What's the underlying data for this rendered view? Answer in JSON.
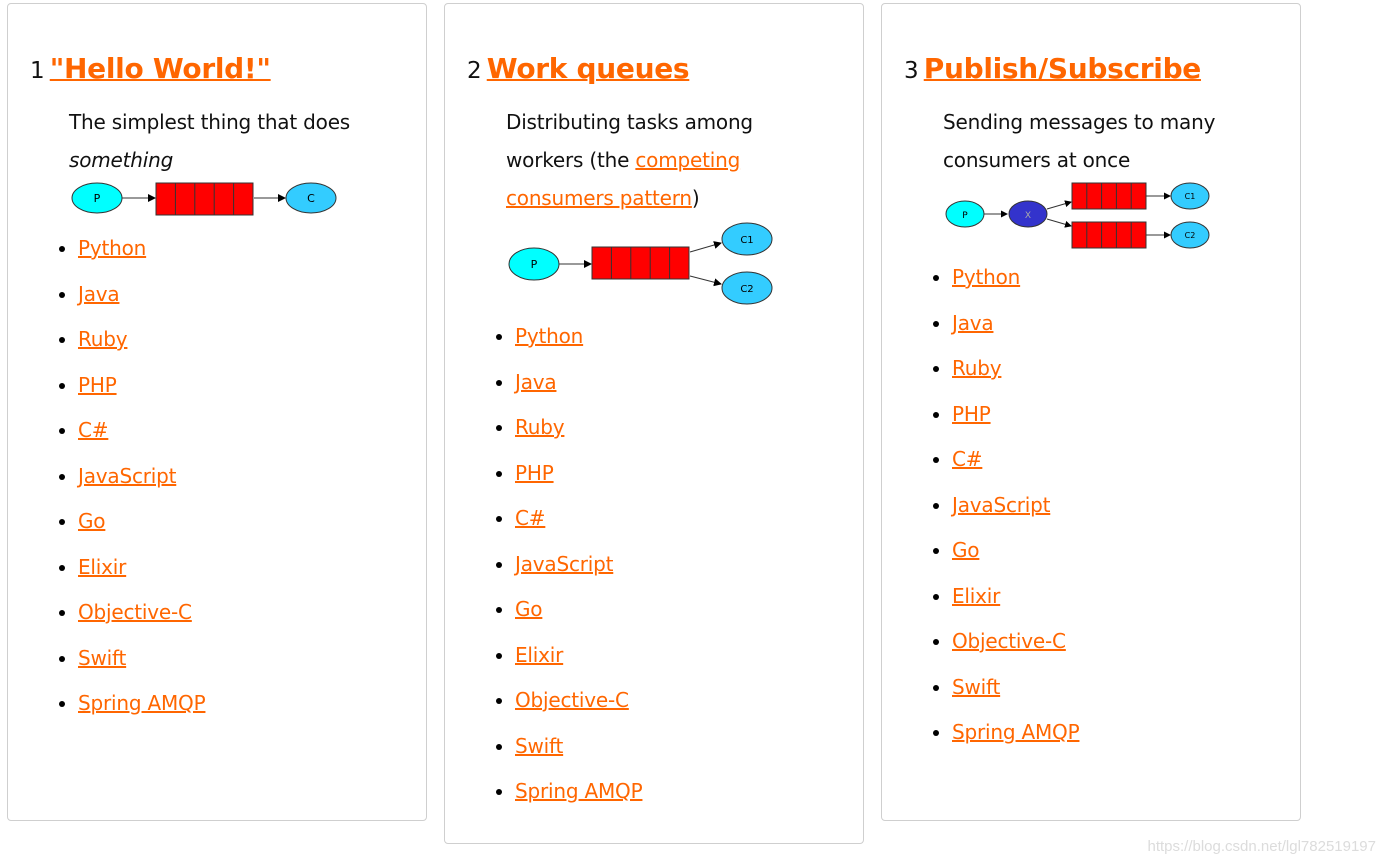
{
  "colors": {
    "link": "#ff6600",
    "queue": "#ff0000",
    "producer": "#00ffff",
    "consumer": "#33ccff",
    "exchange": "#3333cc"
  },
  "tutorials": [
    {
      "number": "1",
      "title": "\"Hello World!\"",
      "description_parts": {
        "text": "The simplest thing that does ",
        "emphasis": "something"
      },
      "diagram": {
        "producer": "P",
        "consumer": "C"
      },
      "languages": [
        "Python",
        "Java",
        "Ruby",
        "PHP",
        "C#",
        "JavaScript",
        "Go",
        "Elixir",
        "Objective-C",
        "Swift",
        "Spring AMQP"
      ]
    },
    {
      "number": "2",
      "title": "Work queues",
      "description_parts": {
        "text": "Distributing tasks among workers (the ",
        "link": "competing consumers pattern",
        "suffix": ")"
      },
      "diagram": {
        "producer": "P",
        "consumers": [
          "C1",
          "C2"
        ]
      },
      "languages": [
        "Python",
        "Java",
        "Ruby",
        "PHP",
        "C#",
        "JavaScript",
        "Go",
        "Elixir",
        "Objective-C",
        "Swift",
        "Spring AMQP"
      ]
    },
    {
      "number": "3",
      "title": "Publish/Subscribe",
      "description_parts": {
        "text": "Sending messages to many consumers at once"
      },
      "diagram": {
        "producer": "P",
        "exchange": "X",
        "consumers": [
          "C1",
          "C2"
        ]
      },
      "languages": [
        "Python",
        "Java",
        "Ruby",
        "PHP",
        "C#",
        "JavaScript",
        "Go",
        "Elixir",
        "Objective-C",
        "Swift",
        "Spring AMQP"
      ]
    }
  ],
  "watermark": "https://blog.csdn.net/lgl782519197"
}
